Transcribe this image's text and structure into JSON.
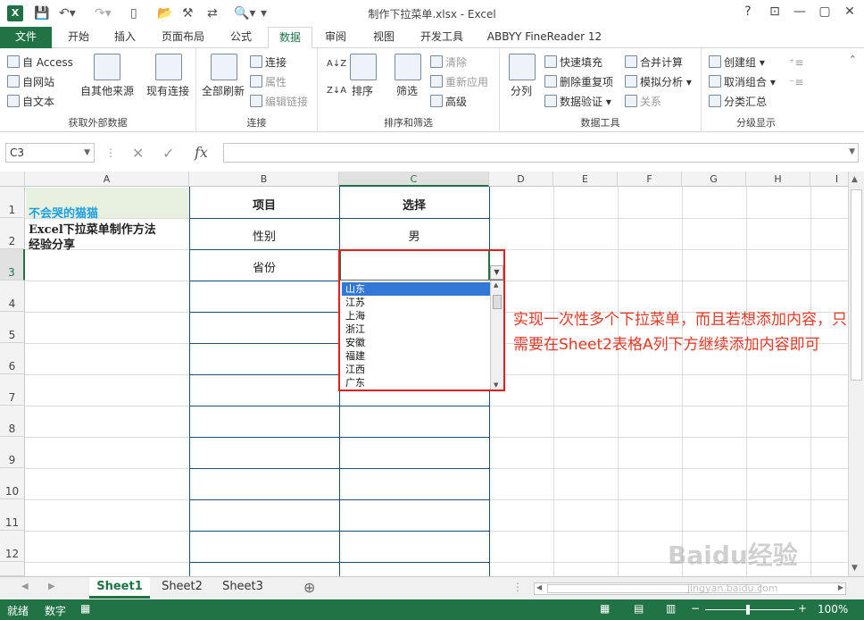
{
  "window": {
    "title": "制作下拉菜单.xlsx - Excel",
    "app_icon": "X"
  },
  "tabs": [
    "文件",
    "开始",
    "插入",
    "页面布局",
    "公式",
    "数据",
    "审阅",
    "视图",
    "开发工具",
    "ABBYY FineReader 12"
  ],
  "active_tab": "数据",
  "login": "登录",
  "ribbon": {
    "g1": {
      "label": "获取外部数据",
      "access": "自 Access",
      "web": "自网站",
      "text": "自文本",
      "other": "自其他来源",
      "existing": "现有连接"
    },
    "g2": {
      "label": "连接",
      "refresh": "全部刷新",
      "connect": "连接",
      "props": "属性",
      "edit_links": "编辑链接"
    },
    "g3": {
      "label": "排序和筛选",
      "sort": "排序",
      "filter": "筛选",
      "clear": "清除",
      "reapply": "重新应用",
      "advanced": "高级"
    },
    "g4": {
      "label": "数据工具",
      "split": "分列",
      "flash": "快速填充",
      "remove_dup": "删除重复项",
      "validate": "数据验证",
      "consolidate": "合并计算",
      "whatif": "模拟分析",
      "relations": "关系"
    },
    "g5": {
      "label": "分级显示",
      "group": "创建组",
      "ungroup": "取消组合",
      "subtotal": "分类汇总"
    }
  },
  "formula_bar": {
    "name_box": "C3",
    "fx": "fx",
    "content": ""
  },
  "columns": [
    "A",
    "B",
    "C",
    "D",
    "E",
    "F",
    "G",
    "H",
    "I"
  ],
  "rows": [
    "1",
    "2",
    "3",
    "4",
    "5",
    "6",
    "7",
    "8",
    "9",
    "10",
    "11",
    "12"
  ],
  "cells": {
    "A1": "不会哭的猫猫",
    "A2a": "Excel下拉菜单制作方法",
    "A2b": "经验分享",
    "B1": "项目",
    "C1": "选择",
    "B2": "性别",
    "C2": "男",
    "B3": "省份"
  },
  "dropdown": {
    "items": [
      "山东",
      "江苏",
      "上海",
      "浙江",
      "安徽",
      "福建",
      "江西",
      "广东"
    ],
    "selected": "山东"
  },
  "annotation": "实现一次性多个下拉菜单，而且若想添加内容，只需要在Sheet2表格A列下方继续添加内容即可",
  "sheets": [
    "Sheet1",
    "Sheet2",
    "Sheet3"
  ],
  "active_sheet": "Sheet1",
  "status": {
    "ready": "就绪",
    "numlock": "数字",
    "zoom": "100%"
  },
  "watermark": "Baidu经验",
  "watermark_url": "jingyan.baidu.com"
}
